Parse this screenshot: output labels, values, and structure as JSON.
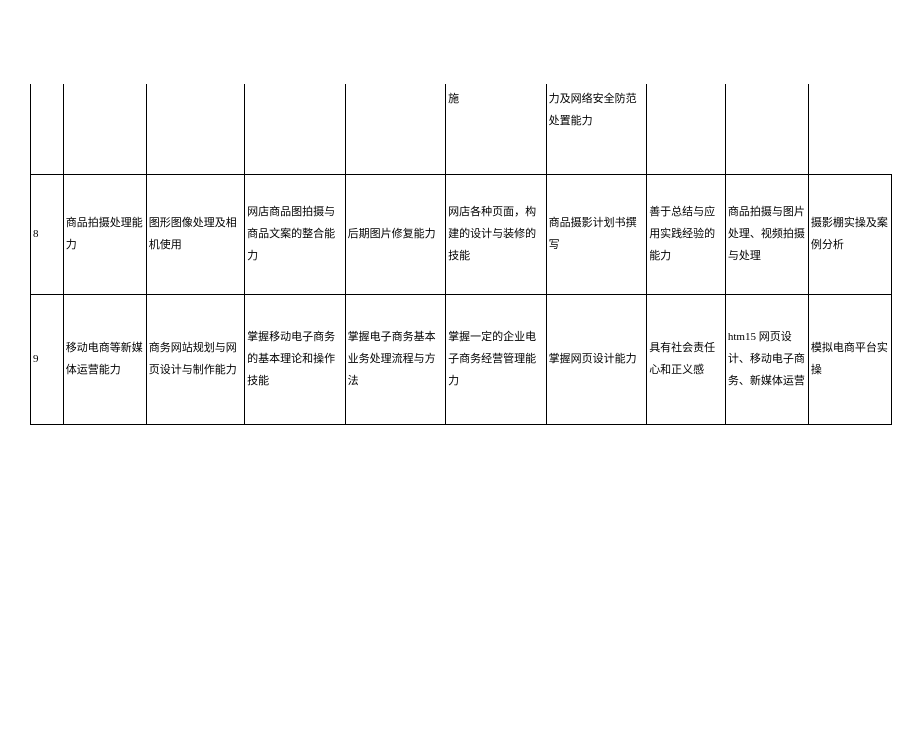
{
  "table": {
    "rows": [
      {
        "id": "row-partial",
        "cells": [
          "",
          "",
          "",
          "",
          "",
          "施",
          "力及网络安全防范处置能力",
          "",
          ""
        ]
      },
      {
        "id": "row-8",
        "cells": [
          "8",
          "商品拍摄处理能力",
          "图形图像处理及相机使用",
          "网店商品图拍摄与商品文案的整合能力",
          "后期图片修复能力",
          "网店各种页面，构建的设计与装修的技能",
          "商品摄影计划书撰写",
          "善于总结与应用实践经验的能力",
          "商品拍摄与图片处理、视频拍摄与处理",
          "摄影棚实操及案例分析"
        ]
      },
      {
        "id": "row-9",
        "cells": [
          "9",
          "移动电商等新媒体运营能力",
          "商务网站规划与网页设计与制作能力",
          "掌握移动电子商务的基本理论和操作技能",
          "掌握电子商务基本业务处理流程与方法",
          "掌握一定的企业电子商务经营管理能力",
          "掌握网页设计能力",
          "具有社会责任心和正义感",
          "htm15 网页设计、移动电子商务、新媒体运营",
          "模拟电商平台实操"
        ]
      }
    ]
  }
}
